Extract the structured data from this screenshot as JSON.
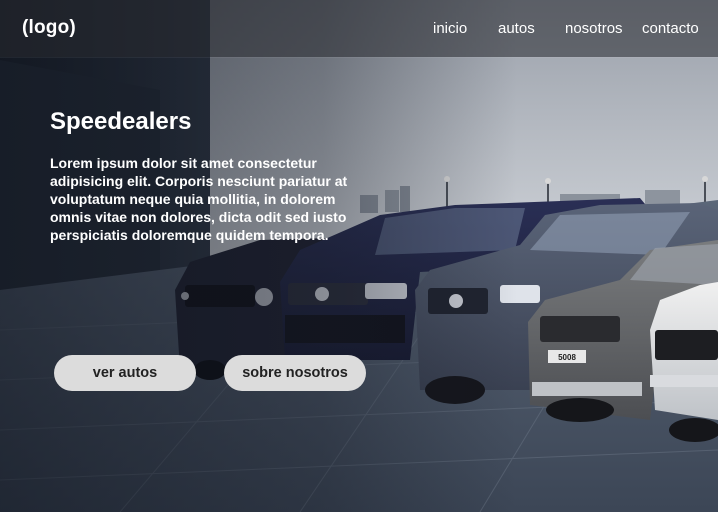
{
  "header": {
    "logo": "(logo)",
    "nav": [
      "inicio",
      "autos",
      "nosotros",
      "contacto"
    ]
  },
  "hero": {
    "title": "Speedealers",
    "text": "Lorem ipsum dolor sit amet consectetur adipisicing elit. Corporis nesciunt pariatur at voluptatum neque quia mollitia, in dolorem omnis vitae non dolores, dicta odit sed iusto perspiciatis doloremque quidem tempora.",
    "buttons": [
      "ver autos",
      "sobre nosotros"
    ]
  },
  "scene": {
    "license_plate": "5008"
  },
  "colors": {
    "button_bg": "#dcdcdc",
    "header_bg": "#2a2c30",
    "text": "#ffffff"
  }
}
